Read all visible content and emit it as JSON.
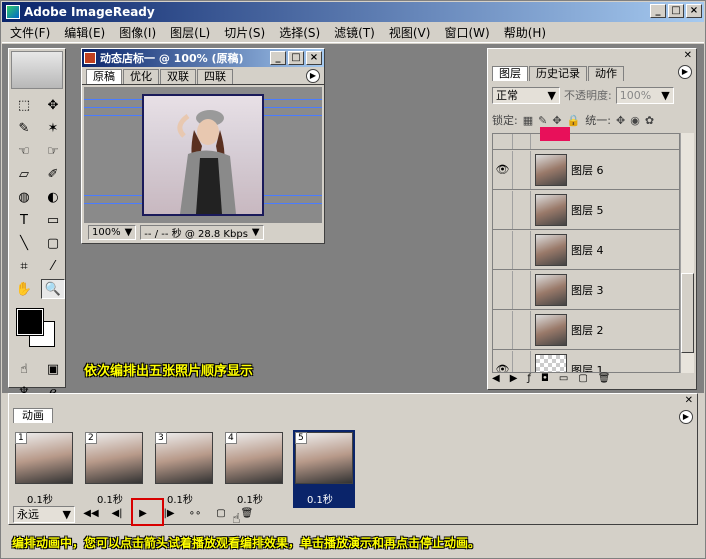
{
  "window": {
    "title": "Adobe ImageReady"
  },
  "menu": [
    "文件(F)",
    "编辑(E)",
    "图像(I)",
    "图层(L)",
    "切片(S)",
    "选择(S)",
    "滤镜(T)",
    "视图(V)",
    "窗口(W)",
    "帮助(H)"
  ],
  "document": {
    "title": "动态店标一 @ 100% (原稿)",
    "tabs": [
      "原稿",
      "优化",
      "双联",
      "四联"
    ],
    "zoom": "100%",
    "status": "-- / -- 秒 @ 28.8 Kbps"
  },
  "layers_panel": {
    "tabs": [
      "图层",
      "历史记录",
      "动作"
    ],
    "blend_mode": "正常",
    "opacity_label": "不透明度:",
    "opacity_value": "100%",
    "lock_label": "锁定:",
    "unify_label": "统一:",
    "layers": [
      {
        "name": "图层 6",
        "visible": true
      },
      {
        "name": "图层 5",
        "visible": false
      },
      {
        "name": "图层 4",
        "visible": false
      },
      {
        "name": "图层 3",
        "visible": false
      },
      {
        "name": "图层 2",
        "visible": false
      },
      {
        "name": "图层 1",
        "visible": true
      }
    ]
  },
  "annotation_top": "依次编排出五张照片顺序显示",
  "animation_panel": {
    "tab": "动画",
    "loop": "永远",
    "frames": [
      {
        "num": "1",
        "delay": "0.1秒"
      },
      {
        "num": "2",
        "delay": "0.1秒"
      },
      {
        "num": "3",
        "delay": "0.1秒"
      },
      {
        "num": "4",
        "delay": "0.1秒"
      },
      {
        "num": "5",
        "delay": "0.1秒"
      }
    ]
  },
  "annotation_bottom": "编排动画中，您可以点击箭头试着播放观看编排效果，单击播放演示和再点击停止动画。"
}
